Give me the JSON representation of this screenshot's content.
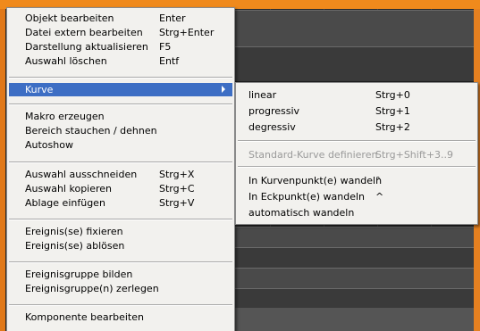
{
  "menu": {
    "items": [
      {
        "label": "Objekt bearbeiten",
        "shortcut": "Enter"
      },
      {
        "label": "Datei extern bearbeiten",
        "shortcut": "Strg+Enter"
      },
      {
        "label": "Darstellung aktualisieren",
        "shortcut": "F5"
      },
      {
        "label": "Auswahl löschen",
        "shortcut": "Entf"
      },
      {
        "label": "Kurve",
        "shortcut": ""
      },
      {
        "label": "Makro erzeugen",
        "shortcut": ""
      },
      {
        "label": "Bereich stauchen / dehnen",
        "shortcut": ""
      },
      {
        "label": "Autoshow",
        "shortcut": ""
      },
      {
        "label": "Auswahl ausschneiden",
        "shortcut": "Strg+X"
      },
      {
        "label": "Auswahl kopieren",
        "shortcut": "Strg+C"
      },
      {
        "label": "Ablage einfügen",
        "shortcut": "Strg+V"
      },
      {
        "label": "Ereignis(se) fixieren",
        "shortcut": ""
      },
      {
        "label": "Ereignis(se) ablösen",
        "shortcut": ""
      },
      {
        "label": "Ereignisgruppe bilden",
        "shortcut": ""
      },
      {
        "label": "Ereignisgruppe(n) zerlegen",
        "shortcut": ""
      },
      {
        "label": "Komponente bearbeiten",
        "shortcut": ""
      }
    ],
    "highlighted_index": 4
  },
  "submenu": {
    "items": [
      {
        "label": "linear",
        "shortcut": "Strg+0"
      },
      {
        "label": "progressiv",
        "shortcut": "Strg+1"
      },
      {
        "label": "degressiv",
        "shortcut": "Strg+2"
      },
      {
        "label": "Standard-Kurve definieren",
        "shortcut": "Strg+Shift+3..9",
        "disabled": true
      },
      {
        "label": "In Kurvenpunkt(e) wandeln",
        "shortcut": "°"
      },
      {
        "label": "In Eckpunkt(e) wandeln",
        "shortcut": "^"
      },
      {
        "label": "automatisch wandeln",
        "shortcut": ""
      }
    ]
  },
  "colors": {
    "frame_accent": "#f08a1c",
    "menu_bg": "#f2f1ee",
    "highlight": "#3d6ec4",
    "disabled_text": "#9a9a9a"
  }
}
